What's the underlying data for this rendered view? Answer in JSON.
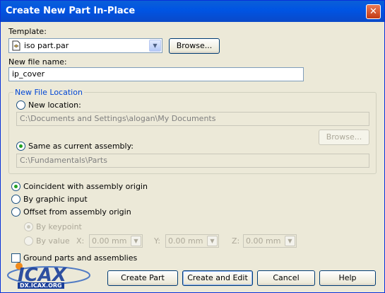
{
  "window": {
    "title": "Create New Part In-Place"
  },
  "template": {
    "label": "Template:",
    "value": "iso part.par",
    "browse_label": "Browse..."
  },
  "filename": {
    "label": "New file name:",
    "value": "ip_cover"
  },
  "location": {
    "legend": "New File Location",
    "new_location_label": "New location:",
    "new_location_path": "C:\\Documents and Settings\\alogan\\My Documents",
    "browse_label": "Browse...",
    "same_as_label": "Same as current assembly:",
    "same_as_path": "C:\\Fundamentals\\Parts"
  },
  "placement": {
    "coincident_label": "Coincident with assembly origin",
    "graphic_label": "By graphic input",
    "offset_label": "Offset from assembly origin",
    "keypoint_label": "By keypoint",
    "value_label": "By value",
    "x_label": "X:",
    "x_value": "0.00 mm",
    "y_label": "Y:",
    "y_value": "0.00 mm",
    "z_label": "Z:",
    "z_value": "0.00 mm"
  },
  "ground_label": "Ground parts and assemblies",
  "buttons": {
    "create_part": "Create Part",
    "create_edit": "Create and Edit",
    "cancel": "Cancel",
    "help": "Help"
  },
  "watermark": {
    "logo_text": "ICAX",
    "url": "DX.ICAX.ORG"
  }
}
